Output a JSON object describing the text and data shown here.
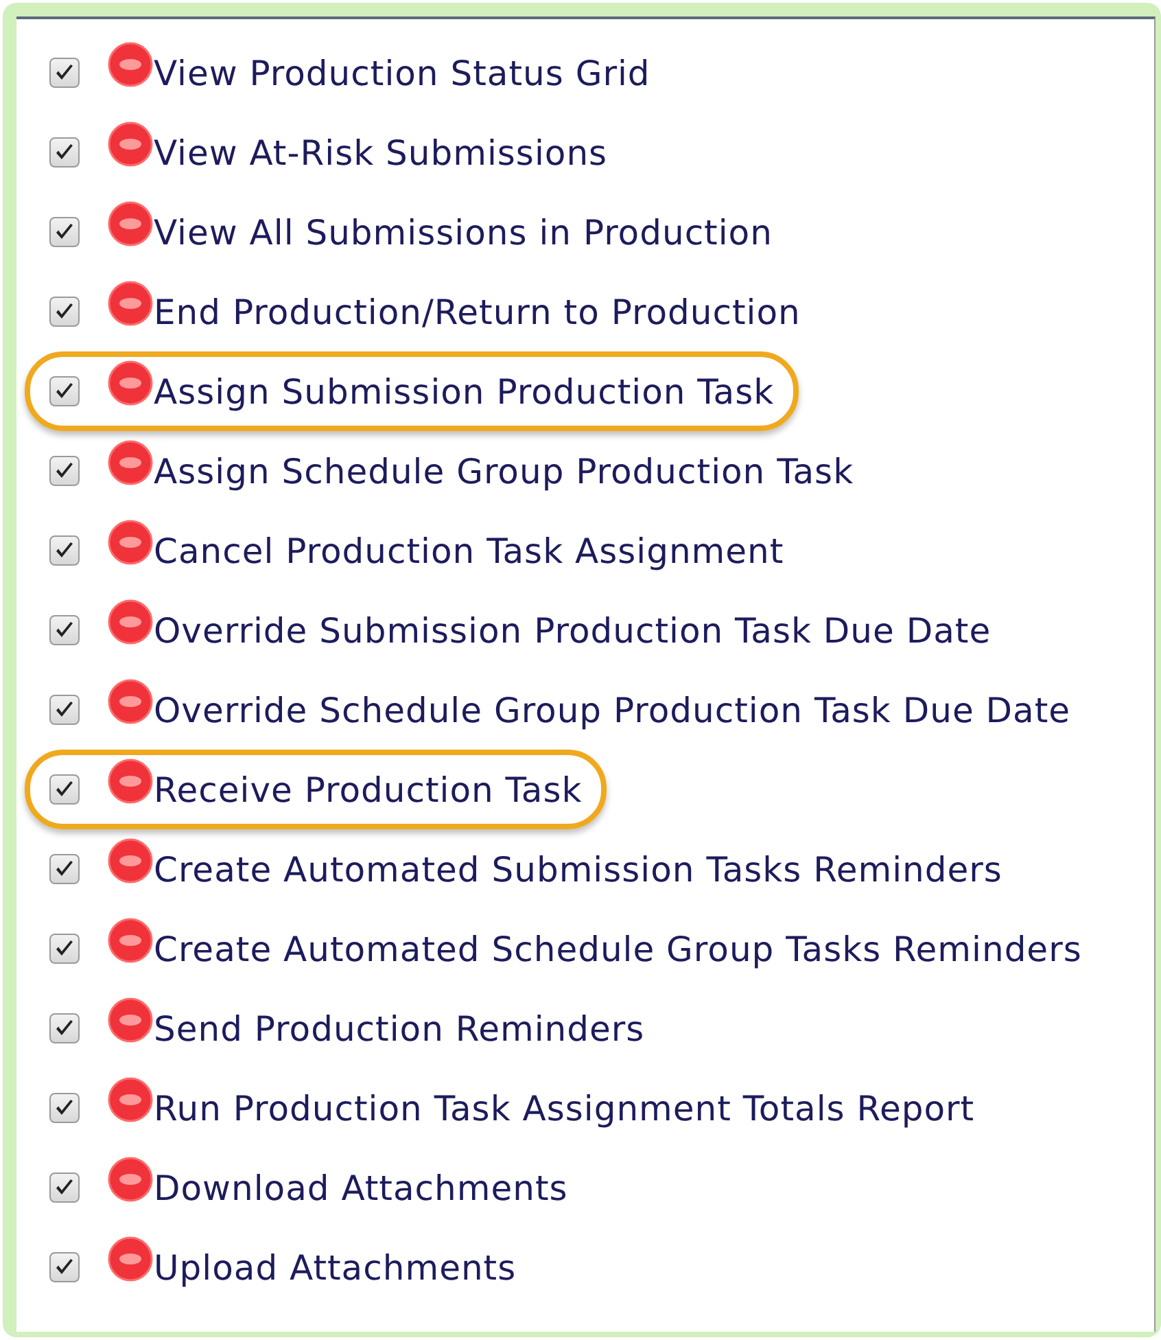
{
  "items": [
    {
      "label": "View Production Status Grid",
      "checked": true,
      "highlighted": false
    },
    {
      "label": "View At-Risk Submissions",
      "checked": true,
      "highlighted": false
    },
    {
      "label": "View All Submissions in Production",
      "checked": true,
      "highlighted": false
    },
    {
      "label": "End Production/Return to Production",
      "checked": true,
      "highlighted": false
    },
    {
      "label": "Assign Submission Production Task",
      "checked": true,
      "highlighted": true
    },
    {
      "label": "Assign Schedule Group Production Task",
      "checked": true,
      "highlighted": false
    },
    {
      "label": "Cancel Production Task Assignment",
      "checked": true,
      "highlighted": false
    },
    {
      "label": "Override Submission Production Task Due Date",
      "checked": true,
      "highlighted": false
    },
    {
      "label": "Override Schedule Group Production Task Due Date",
      "checked": true,
      "highlighted": false
    },
    {
      "label": "Receive Production Task",
      "checked": true,
      "highlighted": true
    },
    {
      "label": "Create Automated Submission Tasks Reminders",
      "checked": true,
      "highlighted": false
    },
    {
      "label": "Create Automated Schedule Group Tasks Reminders",
      "checked": true,
      "highlighted": false
    },
    {
      "label": "Send Production Reminders",
      "checked": true,
      "highlighted": false
    },
    {
      "label": "Run Production Task Assignment Totals Report",
      "checked": true,
      "highlighted": false
    },
    {
      "label": "Download Attachments",
      "checked": true,
      "highlighted": false
    },
    {
      "label": "Upload Attachments",
      "checked": true,
      "highlighted": false
    }
  ]
}
